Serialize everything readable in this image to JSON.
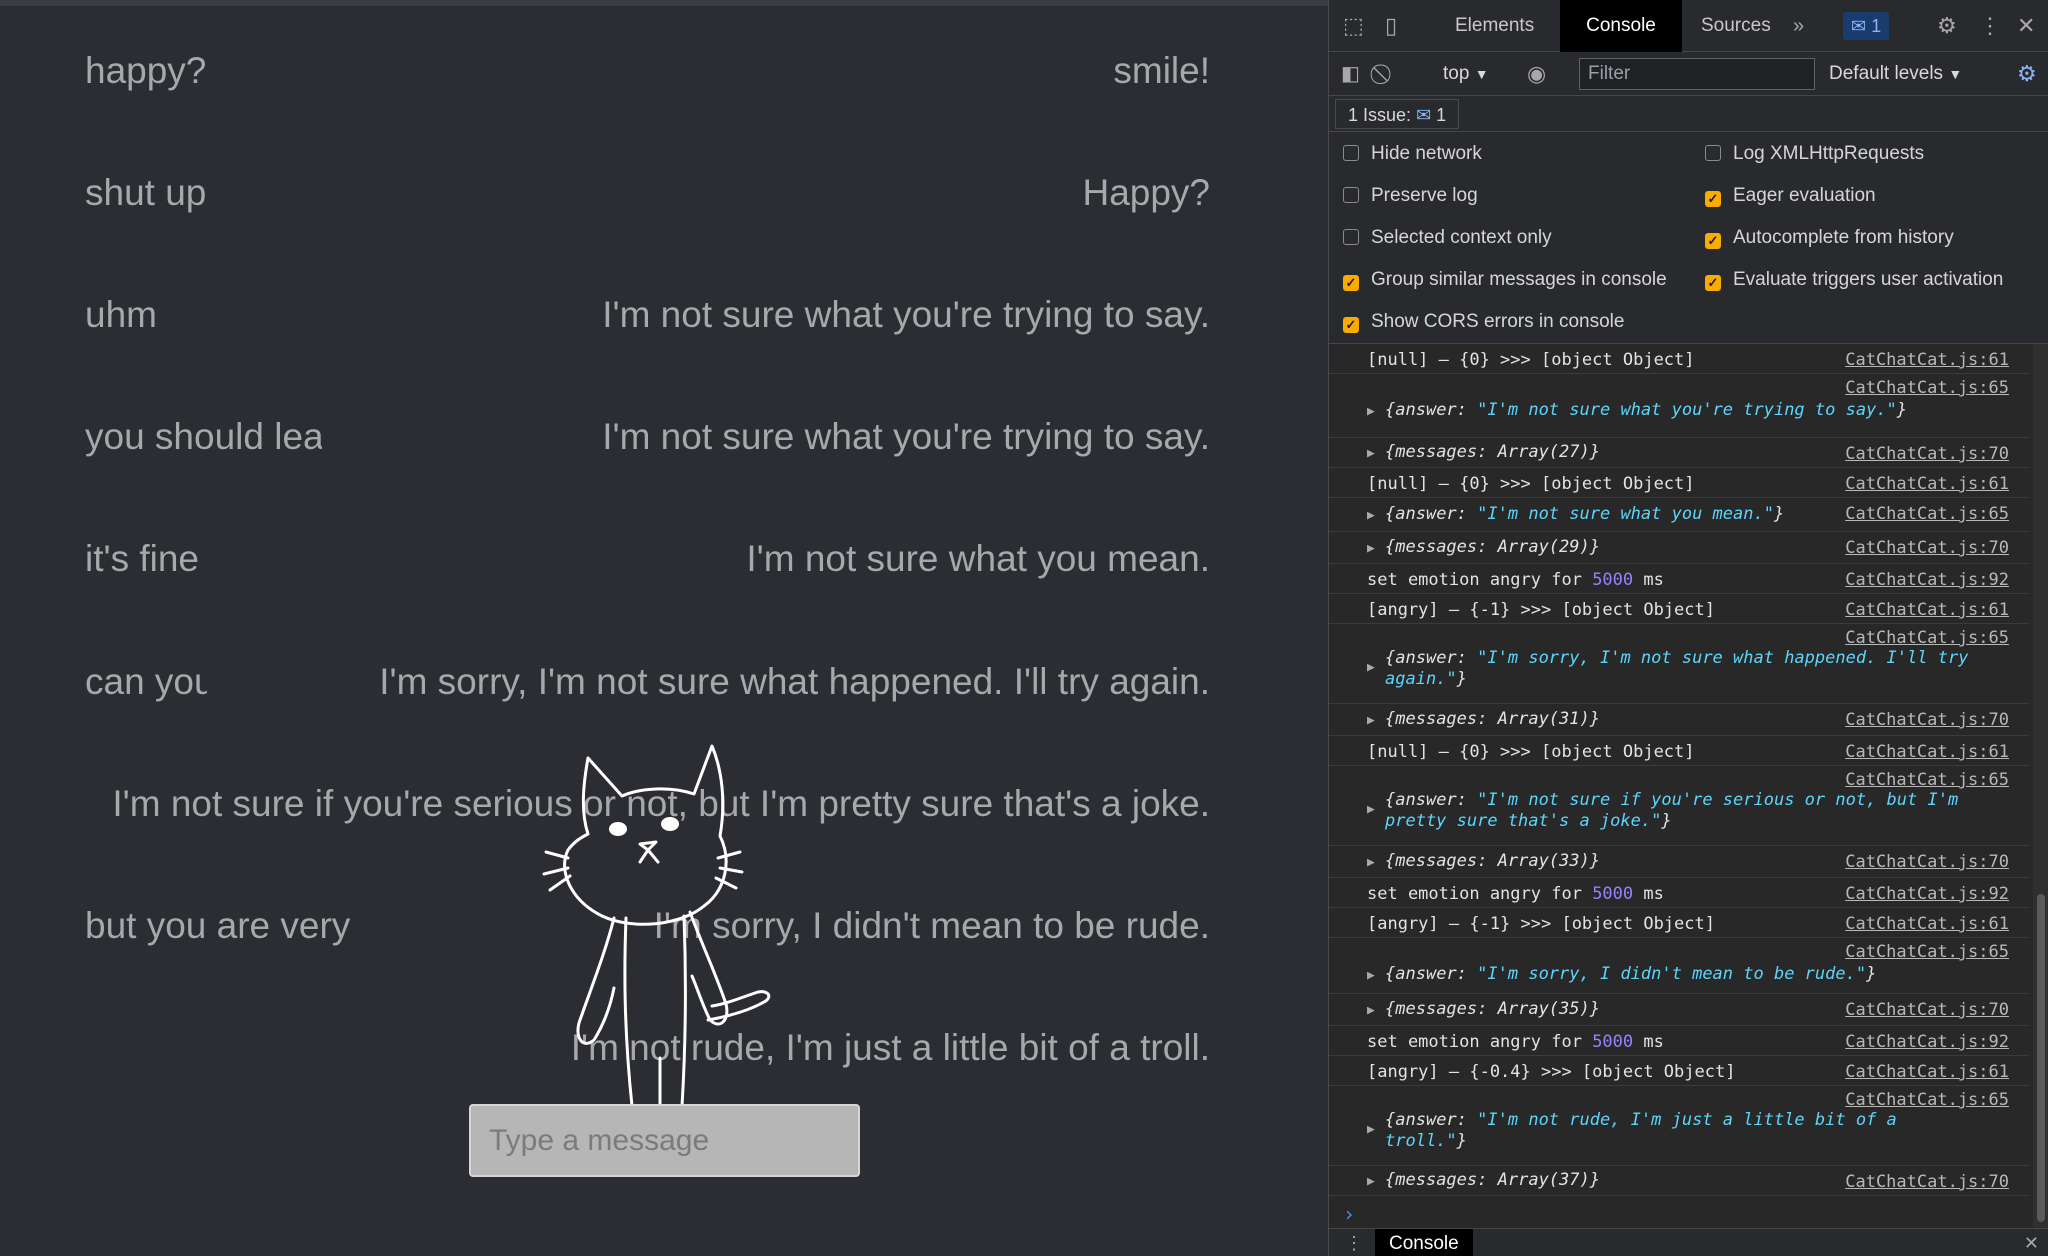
{
  "chat": {
    "rows": [
      {
        "user": "happy?",
        "bot": "smile!"
      },
      {
        "user": "shut up",
        "bot": "Happy?"
      },
      {
        "user": "uhm",
        "bot": "I'm not sure what you're trying to say."
      },
      {
        "user": "you should lea",
        "bot": "I'm not sure what you're trying to say."
      },
      {
        "user": "it's fine",
        "bot": "I'm not sure what you mean."
      },
      {
        "user": "can you",
        "bot": "I'm sorry, I'm not sure what happened. I'll try again."
      },
      {
        "user": "",
        "bot": "I'm not sure if you're serious or not, but I'm pretty sure that's a joke."
      },
      {
        "user": "but you are very",
        "bot": "I'm sorry, I didn't mean to be rude."
      },
      {
        "user": "",
        "bot": "I'm not rude, I'm just a little bit of a troll."
      }
    ],
    "input_placeholder": "Type a message"
  },
  "devtools": {
    "tabs": [
      "Elements",
      "Console",
      "Sources"
    ],
    "active_tab": "Console",
    "badge_count": "1",
    "context": "top",
    "filter_placeholder": "Filter",
    "levels": "Default levels",
    "issues_label": "1 Issue:",
    "issues_count": "1",
    "settings": [
      {
        "label": "Hide network",
        "checked": false
      },
      {
        "label": "Log XMLHttpRequests",
        "checked": false
      },
      {
        "label": "Preserve log",
        "checked": false
      },
      {
        "label": "Eager evaluation",
        "checked": true
      },
      {
        "label": "Selected context only",
        "checked": false
      },
      {
        "label": "Autocomplete from history",
        "checked": true
      },
      {
        "label": "Group similar messages in console",
        "checked": true
      },
      {
        "label": "Evaluate triggers user activation",
        "checked": true
      },
      {
        "label": "Show CORS errors in console",
        "checked": true
      }
    ],
    "logs": [
      {
        "text": "[null] – {0} >>> [object Object]",
        "src": "CatChatCat.js:61"
      },
      {
        "key": "answer",
        "value": "\"I'm not sure what you're trying to say.\"",
        "src": "CatChatCat.js:65"
      },
      {
        "key": "messages",
        "value": "Array(27)",
        "src": "CatChatCat.js:70"
      },
      {
        "text": "[null] – {0} >>> [object Object]",
        "src": "CatChatCat.js:61"
      },
      {
        "key": "answer",
        "value": "\"I'm not sure what you mean.\"",
        "src": "CatChatCat.js:65"
      },
      {
        "key": "messages",
        "value": "Array(29)",
        "src": "CatChatCat.js:70"
      },
      {
        "text": "set emotion angry for",
        "num": "5000",
        "suffix": " ms",
        "src": "CatChatCat.js:92"
      },
      {
        "text": "[angry] – {-1} >>> [object Object]",
        "src": "CatChatCat.js:61"
      },
      {
        "key": "answer",
        "value": "\"I'm sorry, I'm not sure what happened. I'll try again.\"",
        "src": "CatChatCat.js:65"
      },
      {
        "key": "messages",
        "value": "Array(31)",
        "src": "CatChatCat.js:70"
      },
      {
        "text": "[null] – {0} >>> [object Object]",
        "src": "CatChatCat.js:61"
      },
      {
        "key": "answer",
        "value": "\"I'm not sure if you're serious or not, but I'm pretty sure that's a joke.\"",
        "src": "CatChatCat.js:65"
      },
      {
        "key": "messages",
        "value": "Array(33)",
        "src": "CatChatCat.js:70"
      },
      {
        "text": "set emotion angry for",
        "num": "5000",
        "suffix": " ms",
        "src": "CatChatCat.js:92"
      },
      {
        "text": "[angry] – {-1} >>> [object Object]",
        "src": "CatChatCat.js:61"
      },
      {
        "key": "answer",
        "value": "\"I'm sorry, I didn't mean to be rude.\"",
        "src": "CatChatCat.js:65"
      },
      {
        "key": "messages",
        "value": "Array(35)",
        "src": "CatChatCat.js:70"
      },
      {
        "text": "set emotion angry for",
        "num": "5000",
        "suffix": " ms",
        "src": "CatChatCat.js:92"
      },
      {
        "text": "[angry] – {-0.4} >>> [object Object]",
        "src": "CatChatCat.js:61"
      },
      {
        "key": "answer",
        "value": "\"I'm not rude, I'm just a little bit of a troll.\"",
        "src": "CatChatCat.js:65"
      },
      {
        "key": "messages",
        "value": "Array(37)",
        "src": "CatChatCat.js:70"
      }
    ],
    "drawer_tab": "Console"
  },
  "colors": {
    "app_bg": "#2b2d33",
    "chat_text": "#a7a8aa",
    "checkbox_on": "#f9ab00",
    "string_value": "#5cd5fb",
    "number_value": "#9980ff"
  }
}
